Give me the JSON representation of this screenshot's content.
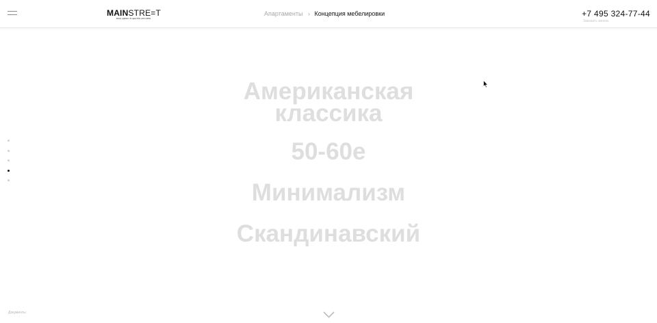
{
  "header": {
    "logo": {
      "bold": "MAIN",
      "light": "STRE=T",
      "tagline": "ВАШ АДРЕС В ЦЕНТРЕ МОСКВЫ"
    },
    "breadcrumb": {
      "parent": "Апартаменты",
      "separator": "›",
      "current": "Концепция мебелировки"
    },
    "phone": "+7 495 324-77-44",
    "callback": "Заказать звонок"
  },
  "styles": [
    {
      "line1": "Американская",
      "line2": "классика"
    },
    {
      "label": "50-60е"
    },
    {
      "label": "Минимализм"
    },
    {
      "label": "Скандинавский"
    }
  ],
  "pagination": {
    "count": 5,
    "active_index": 3
  },
  "footer": {
    "documents": "Документы"
  },
  "icons": {
    "menu": "hamburger-icon",
    "separator": "chevron-right-icon",
    "scroll": "chevron-down-icon",
    "cursor": "mouse-pointer-icon"
  },
  "colors": {
    "style_text": "#dedede",
    "active_dot": "#111111",
    "inactive_dot": "#cfcfcf",
    "muted_text": "#a8a8a8"
  }
}
